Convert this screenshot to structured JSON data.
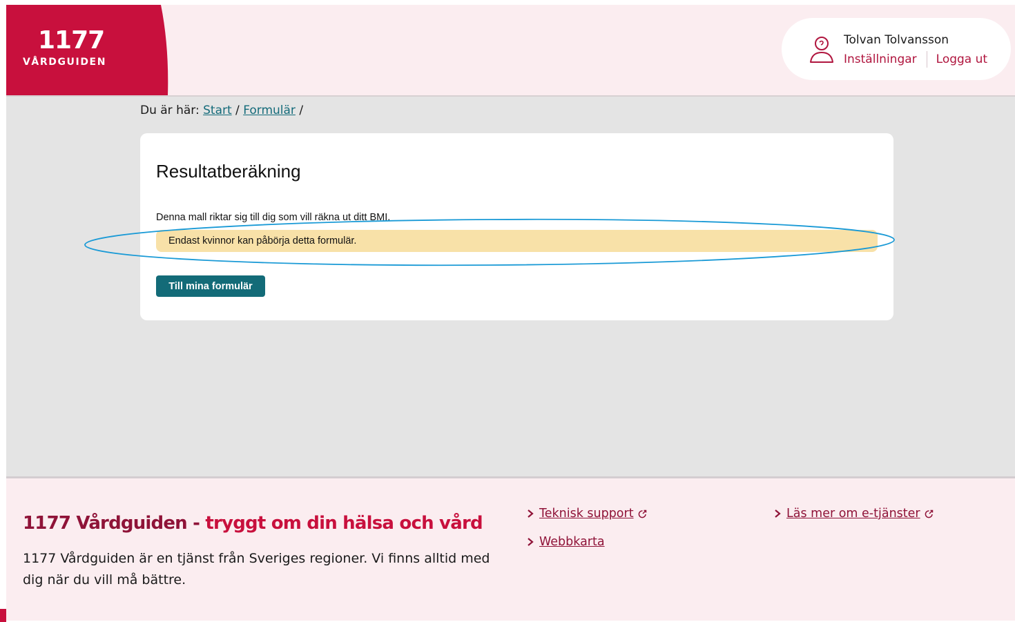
{
  "header": {
    "logo_number": "1177",
    "logo_subtitle": "VÅRDGUIDEN",
    "user_name": "Tolvan Tolvansson",
    "settings_link": "Inställningar",
    "logout_link": "Logga ut"
  },
  "breadcrumb": {
    "prefix": "Du är här:",
    "items": [
      "Start",
      "Formulär"
    ],
    "separator": "/"
  },
  "card": {
    "title": "Resultatberäkning",
    "description": "Denna mall riktar sig till dig som vill räkna ut ditt BMI.",
    "notice": "Endast kvinnor kan påbörja detta formulär.",
    "button_label": "Till mina formulär"
  },
  "footer": {
    "heading_part1": "1177 Vårdguiden - ",
    "heading_part2": "tryggt om din hälsa och vård",
    "description": "1177 Vårdguiden är en tjänst från Sveriges regioner. Vi finns alltid med dig när du vill må bättre.",
    "links": [
      {
        "label": "Teknisk support",
        "external": true
      },
      {
        "label": "Webbkarta",
        "external": false
      },
      {
        "label": "Läs mer om e-tjänster",
        "external": true
      }
    ]
  },
  "colors": {
    "brand_red": "#c8103d",
    "brand_dark_red": "#8f1338",
    "teal": "#136b78",
    "notice_yellow": "#f8e1a8",
    "highlight_blue": "#1a9ad6"
  }
}
